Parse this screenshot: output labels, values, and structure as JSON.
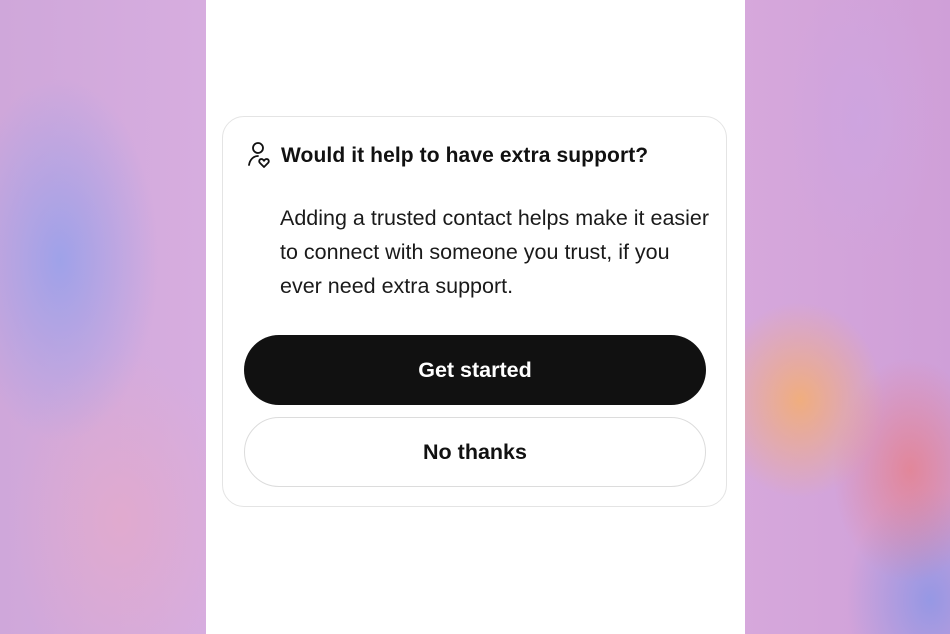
{
  "dialog": {
    "icon": "person-heart-icon",
    "title": "Would it help to have extra support?",
    "body": "Adding a trusted contact helps make it easier to connect with someone you trust, if you ever need extra support."
  },
  "buttons": {
    "primary_label": "Get started",
    "secondary_label": "No thanks"
  },
  "colors": {
    "primary_button": "#111111",
    "primary_button_text": "#ffffff",
    "card_border": "#e4e4e4",
    "background_accent": "#d6b2e4"
  }
}
